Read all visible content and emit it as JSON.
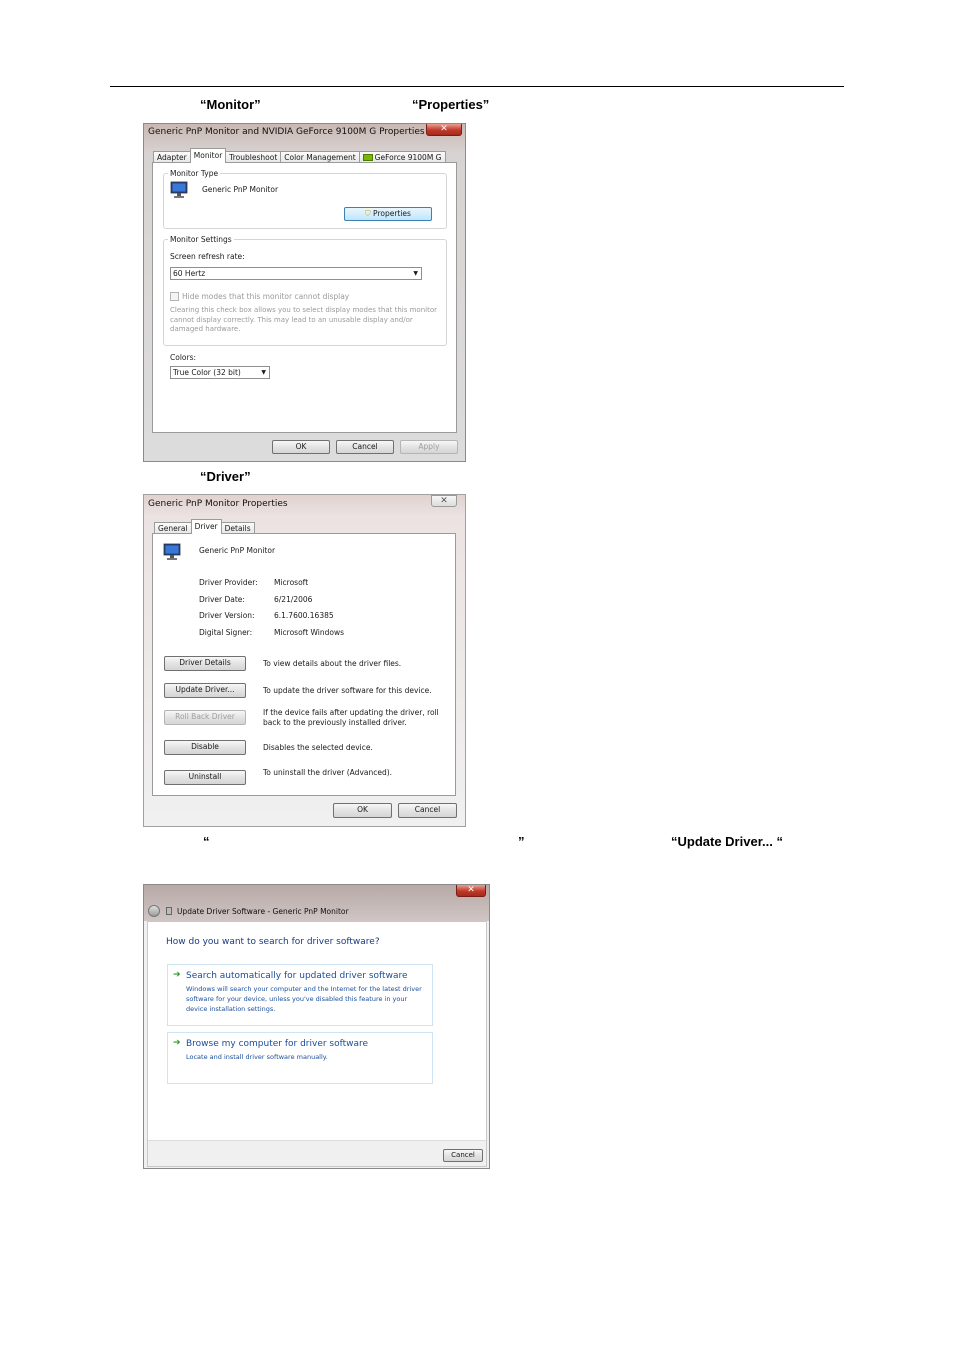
{
  "captions": {
    "c1_monitor": "“Monitor”",
    "c1_properties": "“Properties”",
    "c2_driver": "“Driver”",
    "c3_open_quote": "“",
    "c3_close_quote": "”",
    "c3_update_driver": "“Update Driver... “"
  },
  "win1": {
    "title": "Generic PnP Monitor and NVIDIA GeForce 9100M G   Properties",
    "close": "✕",
    "tabs": [
      "Adapter",
      "Monitor",
      "Troubleshoot",
      "Color Management",
      "GeForce 9100M G"
    ],
    "monitor_type_label": "Monitor Type",
    "monitor_name": "Generic PnP Monitor",
    "properties_button": "Properties",
    "monitor_settings_label": "Monitor Settings",
    "refresh_label": "Screen refresh rate:",
    "refresh_value": "60 Hertz",
    "hide_modes": "Hide modes that this monitor cannot display",
    "warning": "Clearing this check box allows you to select display modes that this monitor cannot display correctly. This may lead to an unusable display and/or damaged hardware.",
    "colors_label": "Colors:",
    "colors_value": "True Color (32 bit)",
    "ok": "OK",
    "cancel": "Cancel",
    "apply": "Apply"
  },
  "win2": {
    "title": "Generic PnP Monitor Properties",
    "close": "✕",
    "tabs": [
      "General",
      "Driver",
      "Details"
    ],
    "device_name": "Generic PnP Monitor",
    "fields": [
      {
        "label": "Driver Provider:",
        "value": "Microsoft"
      },
      {
        "label": "Driver Date:",
        "value": "6/21/2006"
      },
      {
        "label": "Driver Version:",
        "value": "6.1.7600.16385"
      },
      {
        "label": "Digital Signer:",
        "value": "Microsoft Windows"
      }
    ],
    "actions": [
      {
        "button": "Driver Details",
        "desc": "To view details about the driver files."
      },
      {
        "button": "Update Driver...",
        "desc": "To update the driver software for this device."
      },
      {
        "button": "Roll Back Driver",
        "desc": "If the device fails after updating the driver, roll back to the previously installed driver."
      },
      {
        "button": "Disable",
        "desc": "Disables the selected device."
      },
      {
        "button": "Uninstall",
        "desc": "To uninstall the driver (Advanced)."
      }
    ],
    "ok": "OK",
    "cancel": "Cancel"
  },
  "win3": {
    "title": "Update Driver Software - Generic PnP Monitor",
    "close": "✕",
    "heading": "How do you want to search for driver software?",
    "option1_title": "Search automatically for updated driver software",
    "option1_desc": "Windows will search your computer and the Internet for the latest driver software for your device, unless you've disabled this feature in your device installation settings.",
    "option2_title": "Browse my computer for driver software",
    "option2_desc": "Locate and install driver software manually.",
    "cancel": "Cancel"
  }
}
